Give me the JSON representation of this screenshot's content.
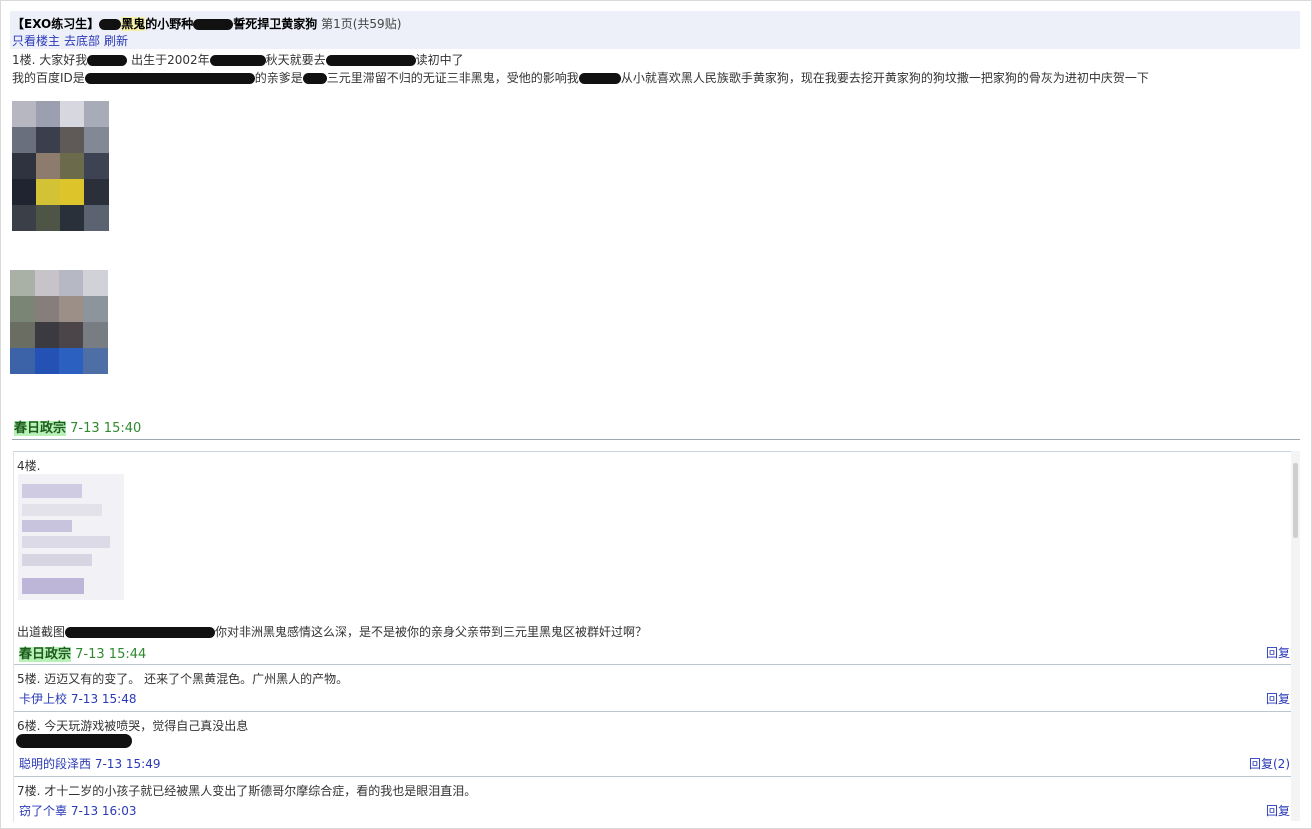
{
  "header": {
    "title_prefix": "【EXO练习生】",
    "title_mid": "黑鬼",
    "title_mid2": "的小野种",
    "title_suffix": "誓死捍卫黄家狗",
    "pages": "第1页(共59贴)",
    "nav": [
      "只看楼主",
      "去底部",
      "刷新"
    ]
  },
  "first_post": {
    "line1_a": "1楼. 大家好我",
    "line1_b": "出生于2002年",
    "line1_c": "秋天就要去",
    "line1_d": "读初中了",
    "line2_a": "我的百度ID是",
    "line2_b": "的亲爹是",
    "line2_c": "三元里滞留不归的无证三非黑鬼，受他的影响我",
    "line2_d": "从小就喜欢黑人民族歌手黄家狗，现在我要去挖开黄家狗的狗坟撒一把家狗的骨灰为进初中庆贺一下",
    "author": "春日政宗",
    "time": "7-13 15:40"
  },
  "replies": [
    {
      "floor": "4楼.",
      "text_a": "出道截图",
      "text_b": "你对非洲黑鬼感情这么深，是不是被你的亲身父亲带到三元里黑鬼区被群奸过啊？",
      "author": "春日政宗",
      "time": "7-13 15:44",
      "reply_label": "回复"
    },
    {
      "text": "5楼. 迈迈又有的变了。 还来了个黑黄混色。广州黑人的产物。",
      "author": "卡伊上校",
      "time": "7-13 15:48",
      "reply_label": "回复"
    },
    {
      "text": "6楼. 今天玩游戏被喷哭，觉得自己真没出息",
      "author": "聪明的段泽西",
      "time": "7-13 15:49",
      "reply_label": "回复(2)"
    },
    {
      "text": "7楼. 才十二岁的小孩子就已经被黑人变出了斯德哥尔摩综合症，看的我也是眼泪直泪。",
      "author": "窃了个辜",
      "time": "7-13 16:03",
      "reply_label": "回复"
    }
  ],
  "colors": {
    "header_bg": "#eef0f9",
    "link": "#2a39b8",
    "author_bg": "#b8f0b8",
    "time_green": "#2f8a2f",
    "highlight": "#f7f1a7"
  }
}
